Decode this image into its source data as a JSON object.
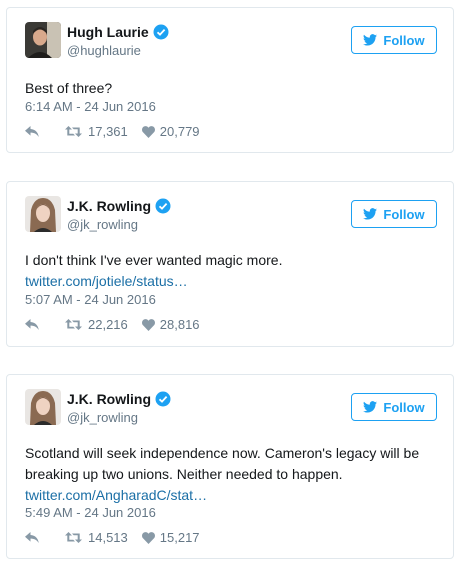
{
  "colors": {
    "accent": "#1da1f2",
    "link": "#1b6fa6",
    "muted": "#657786",
    "border": "#e1e8ed"
  },
  "tweets": [
    {
      "author": "Hugh Laurie",
      "handle": "@hughlaurie",
      "verified": true,
      "follow_label": "Follow",
      "text": "Best of three?",
      "link": "",
      "time": "6:14 AM - 24 Jun 2016",
      "retweets": "17,361",
      "likes": "20,779"
    },
    {
      "author": "J.K. Rowling",
      "handle": "@jk_rowling",
      "verified": true,
      "follow_label": "Follow",
      "text": "I don't think I've ever wanted magic more.",
      "link": "twitter.com/jotiele/status…",
      "time": "5:07 AM - 24 Jun 2016",
      "retweets": "22,216",
      "likes": "28,816"
    },
    {
      "author": "J.K. Rowling",
      "handle": "@jk_rowling",
      "verified": true,
      "follow_label": "Follow",
      "text": "Scotland will seek independence now. Cameron's legacy will be breaking up two unions. Neither needed to happen.",
      "link": "twitter.com/AngharadC/stat…",
      "time": "5:49 AM - 24 Jun 2016",
      "retweets": "14,513",
      "likes": "15,217"
    }
  ]
}
